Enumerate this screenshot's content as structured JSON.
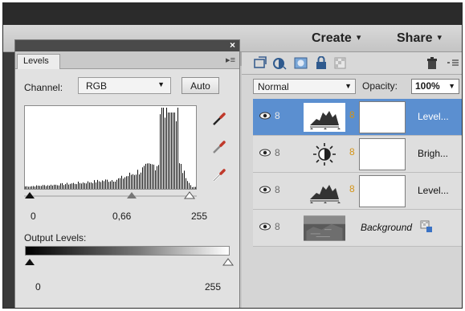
{
  "app": {
    "create_label": "Create",
    "share_label": "Share"
  },
  "levels_panel": {
    "close_glyph": "×",
    "tab_label": "Levels",
    "channel_label": "Channel:",
    "channel_value": "RGB",
    "auto_label": "Auto",
    "input_black": "0",
    "input_gamma": "0,66",
    "input_white": "255",
    "output_label": "Output Levels:",
    "output_black": "0",
    "output_white": "255"
  },
  "layers_panel": {
    "blend_mode": "Normal",
    "opacity_label": "Opacity:",
    "opacity_value": "100%",
    "layers": [
      {
        "name": "Level...",
        "type": "adjustment-levels",
        "selected": true
      },
      {
        "name": "Brigh...",
        "type": "adjustment-brightness",
        "selected": false
      },
      {
        "name": "Level...",
        "type": "adjustment-levels",
        "selected": false
      },
      {
        "name": "Background",
        "type": "image",
        "selected": false
      }
    ]
  },
  "colors": {
    "selection": "#5b8fd0",
    "panel_bg": "#e1e1e1",
    "link_icon": "#d49418"
  },
  "icons": [
    "close-icon",
    "panel-menu-icon",
    "black-point-eyedropper-icon",
    "gray-point-eyedropper-icon",
    "white-point-eyedropper-icon",
    "new-layer-icon",
    "fill-adjustment-icon",
    "add-mask-icon",
    "lock-icon",
    "lock-transparency-icon",
    "trash-icon",
    "eye-icon",
    "link-icon",
    "chain-icon"
  ]
}
